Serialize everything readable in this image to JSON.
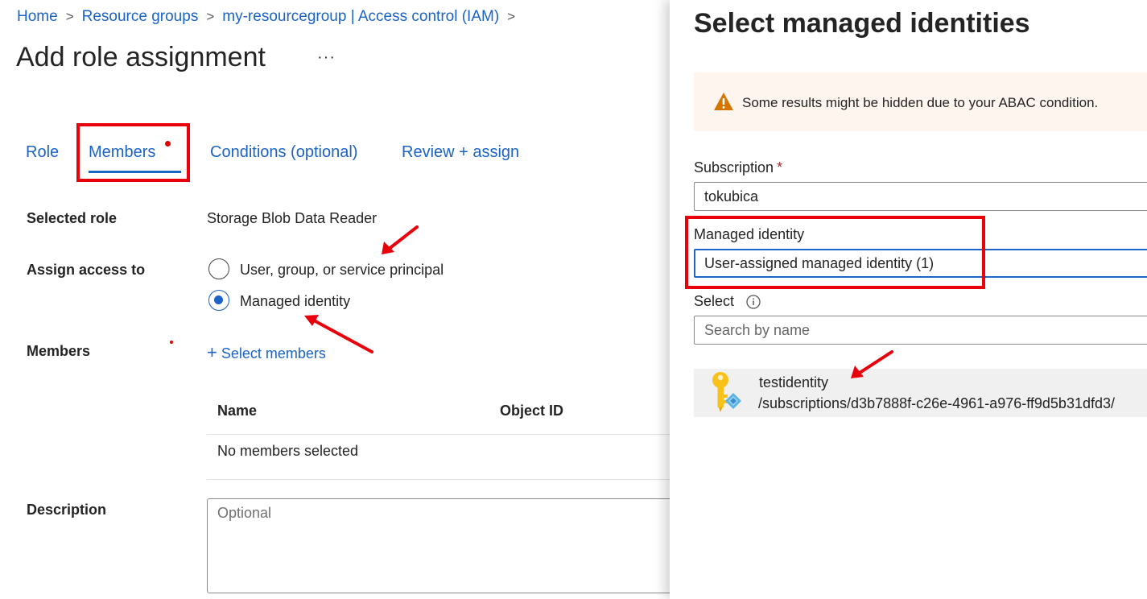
{
  "breadcrumb": {
    "home": "Home",
    "resource_groups": "Resource groups",
    "iam": "my-resourcegroup | Access control (IAM)"
  },
  "page": {
    "title": "Add role assignment",
    "more": "···"
  },
  "tabs": {
    "role": "Role",
    "members": "Members",
    "conditions": "Conditions (optional)",
    "review": "Review + assign"
  },
  "form": {
    "selected_role_label": "Selected role",
    "selected_role_value": "Storage Blob Data Reader",
    "assign_access_label": "Assign access to",
    "option_user": "User, group, or service principal",
    "option_mi": "Managed identity",
    "selected_option": "Managed identity",
    "members_label": "Members",
    "select_members": "Select members",
    "table_name_header": "Name",
    "table_objectid_header": "Object ID",
    "table_empty": "No members selected",
    "description_label": "Description",
    "description_placeholder": "Optional"
  },
  "panel": {
    "title": "Select managed identities",
    "warning": "Some results might be hidden due to your ABAC condition.",
    "subscription_label": "Subscription",
    "subscription_required": "*",
    "subscription_value": "tokubica",
    "mi_label": "Managed identity",
    "mi_value": "User-assigned managed identity (1)",
    "select_label": "Select",
    "search_placeholder": "Search by name",
    "result_name": "testidentity",
    "result_path": "/subscriptions/d3b7888f-c26e-4961-a976-ff9d5b31dfd3/"
  },
  "colors": {
    "accent": "#1b63c6",
    "annotation": "#e8000b",
    "warning": "#d47500"
  },
  "icons": [
    "chevron-right-icon",
    "plus-icon",
    "warning-icon",
    "info-icon",
    "managed-identity-key-icon",
    "annotation-arrow"
  ]
}
